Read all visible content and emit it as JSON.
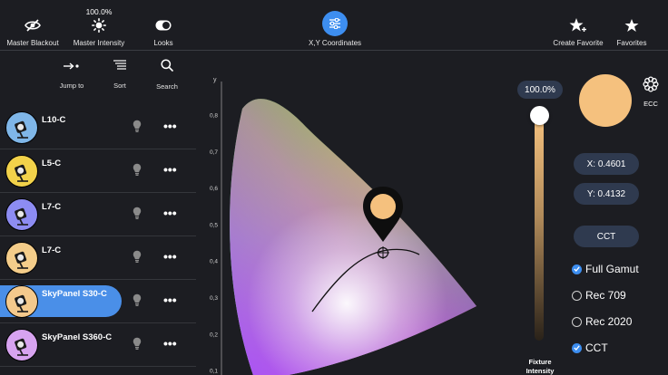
{
  "toolbar": {
    "master_blackout": "Master Blackout",
    "master_intensity": "Master Intensity",
    "master_intensity_value": "100.0%",
    "looks": "Looks",
    "xy_coordinates": "X,Y Coordinates",
    "create_favorite": "Create Favorite",
    "favorites": "Favorites"
  },
  "subtools": {
    "jump_to": "Jump to",
    "sort": "Sort",
    "search": "Search"
  },
  "fixtures": [
    {
      "name": "L10-C",
      "ring": "#7fb6e8",
      "icon_color": "#ffffff"
    },
    {
      "name": "L5-C",
      "ring": "#f2d24a",
      "icon_color": "#ffffff"
    },
    {
      "name": "L7-C",
      "ring": "#8d8cf2",
      "icon_color": "#ffffff"
    },
    {
      "name": "L7-C",
      "ring": "#f4cd8a",
      "icon_color": "#ffffff"
    },
    {
      "name": "SkyPanel S30-C",
      "ring": "#f4c98c",
      "icon_color": "#ffffff",
      "selected": true
    },
    {
      "name": "SkyPanel S360-C",
      "ring": "#d7a3f0",
      "icon_color": "#ffffff"
    }
  ],
  "chart": {
    "y_axis_label": "y",
    "y_ticks": [
      "0,8",
      "0,7",
      "0,6",
      "0,5",
      "0,4",
      "0,3",
      "0,2",
      "0,1"
    ]
  },
  "right_panel": {
    "intensity_value": "100.0%",
    "fixture_intensity": "Fixture Intensity",
    "ecc": "ECC",
    "x_value": "X: 0.4601",
    "y_value": "Y: 0.4132",
    "cct_button": "CCT",
    "swatch_color": "#f5c17e",
    "options": [
      {
        "label": "Full Gamut",
        "checked": true
      },
      {
        "label": "Rec 709",
        "checked": false
      },
      {
        "label": "Rec 2020",
        "checked": false
      },
      {
        "label": "CCT",
        "checked": true
      }
    ]
  },
  "colors": {
    "accent": "#3d8ef0",
    "background": "#1c1d22",
    "pill": "#2f3a4f"
  }
}
